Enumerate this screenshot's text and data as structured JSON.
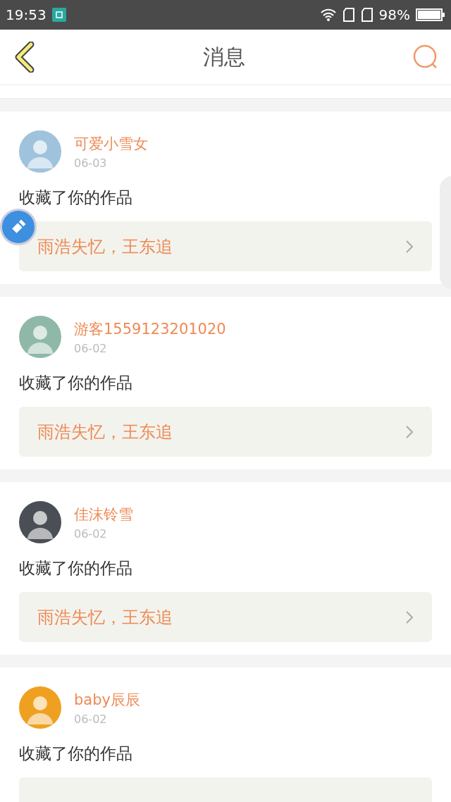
{
  "status_bar": {
    "time": "19:53",
    "battery": "98%"
  },
  "header": {
    "title": "消息"
  },
  "messages": [
    {
      "user": "可爱小雪女",
      "date": "06-03",
      "action": "收藏了你的作品",
      "work": "雨浩失忆，王东追"
    },
    {
      "user": "游客1559123201020",
      "date": "06-02",
      "action": "收藏了你的作品",
      "work": "雨浩失忆，王东追"
    },
    {
      "user": "佳沫铃雪",
      "date": "06-02",
      "action": "收藏了你的作品",
      "work": "雨浩失忆，王东追"
    },
    {
      "user": "baby辰辰",
      "date": "06-02",
      "action": "收藏了你的作品"
    }
  ]
}
